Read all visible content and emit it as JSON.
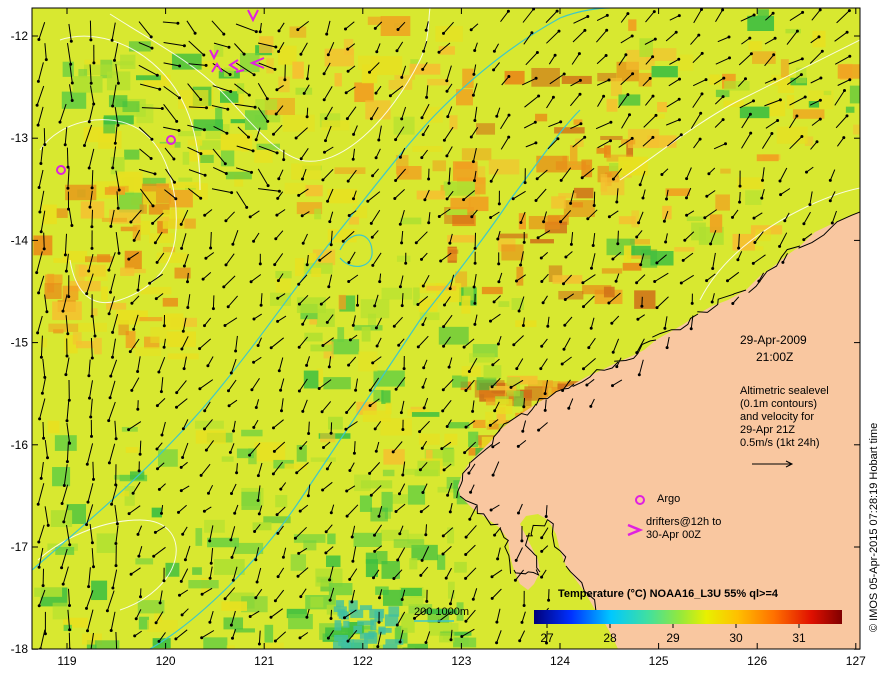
{
  "map": {
    "lat_ticks": [
      "-12",
      "-13",
      "-14",
      "-15",
      "-16",
      "-17",
      "-18"
    ],
    "lon_ticks": [
      "119",
      "120",
      "121",
      "122",
      "123",
      "124",
      "125",
      "126",
      "127"
    ],
    "colors": {
      "land": "#f9c7a0",
      "sea_base": "#d8e830",
      "contour": "#ffffff",
      "isobath": "#3ec8c8",
      "argo": "#e020e0",
      "drifter": "#e020e0",
      "arrow": "#000000"
    }
  },
  "info": {
    "date": "29-Apr-2009",
    "time": "21:00Z",
    "desc_lines": [
      "Altimetric sealevel",
      "(0.1m contours)",
      "and velocity for",
      "29-Apr 21Z",
      "0.5m/s (1kt 24h)"
    ],
    "argo_label": "Argo",
    "drifters_line1": "drifters@12h to",
    "drifters_line2": "30-Apr 00Z",
    "isobath_label": "200  1000m"
  },
  "colorbar": {
    "title": "Temperature (°C) NOAA16_L3U 55% ql>=4",
    "ticks": [
      "27",
      "28",
      "29",
      "30",
      "31"
    ]
  },
  "credit": "© IMOS 05-Apr-2015 07:28:19 Hobart time"
}
